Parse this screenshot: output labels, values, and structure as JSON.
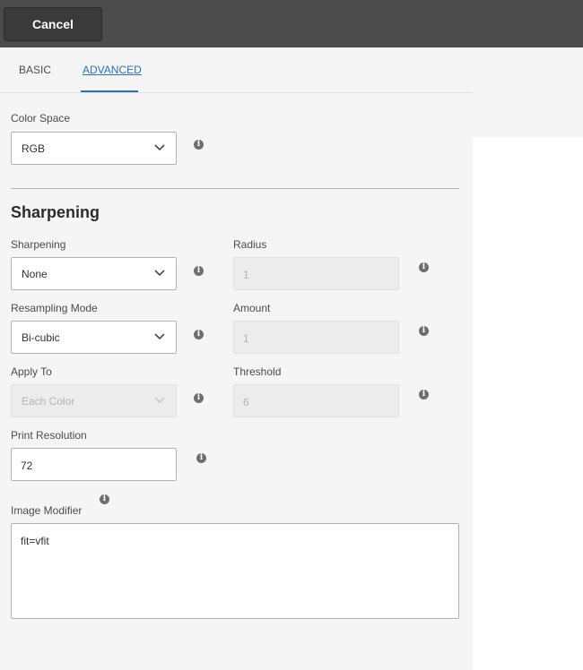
{
  "toolbar": {
    "cancel_label": "Cancel"
  },
  "tabs": {
    "basic": "BASIC",
    "advanced": "ADVANCED"
  },
  "color_space": {
    "label": "Color Space",
    "value": "RGB"
  },
  "sharpening_section": {
    "title": "Sharpening"
  },
  "sharpening": {
    "label": "Sharpening",
    "value": "None"
  },
  "radius": {
    "label": "Radius",
    "value": "1"
  },
  "resampling_mode": {
    "label": "Resampling Mode",
    "value": "Bi-cubic"
  },
  "amount": {
    "label": "Amount",
    "value": "1"
  },
  "apply_to": {
    "label": "Apply To",
    "value": "Each Color"
  },
  "threshold": {
    "label": "Threshold",
    "value": "6"
  },
  "print_resolution": {
    "label": "Print Resolution",
    "value": "72"
  },
  "image_modifier": {
    "label": "Image Modifier",
    "value": "fit=vfit"
  },
  "info_glyph": "i",
  "colors": {
    "accent": "#2d6fbf",
    "topbar": "#4b4b4b",
    "panel": "#f5f5f5"
  }
}
